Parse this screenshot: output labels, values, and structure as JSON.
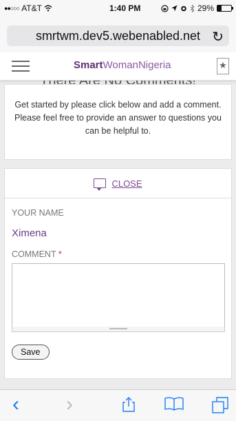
{
  "status_bar": {
    "carrier": "AT&T",
    "signal_dots": "●●○○○",
    "time": "1:40 PM",
    "battery_percent": "29%",
    "battery_level": 0.29
  },
  "browser": {
    "url": "smrtwm.dev5.webenabled.net"
  },
  "site": {
    "logo_smart": "Smart",
    "logo_woman": "Woman",
    "logo_nigeria": "Nigeria"
  },
  "comments": {
    "empty_heading": "There Are No Comments!",
    "empty_line1": "Get started by please click below and add a comment.",
    "empty_line2": "Please feel free to provide an answer to questions you can be helpful to.",
    "close_label": "CLOSE"
  },
  "form": {
    "name_label": "YOUR NAME",
    "name_value": "Ximena",
    "comment_label": "COMMENT",
    "required_mark": "*",
    "comment_value": "",
    "save_label": "Save"
  },
  "colors": {
    "brand": "#7a4a8e",
    "link": "#1a7cf5",
    "required": "#d03030"
  },
  "icons": {
    "reload": "reload-icon",
    "menu": "hamburger-icon",
    "bookmark": "bookmark-icon",
    "comment": "comment-icon",
    "back": "back-icon",
    "forward": "forward-icon",
    "share": "share-icon",
    "bookmarks": "bookmarks-icon",
    "tabs": "tabs-icon"
  }
}
